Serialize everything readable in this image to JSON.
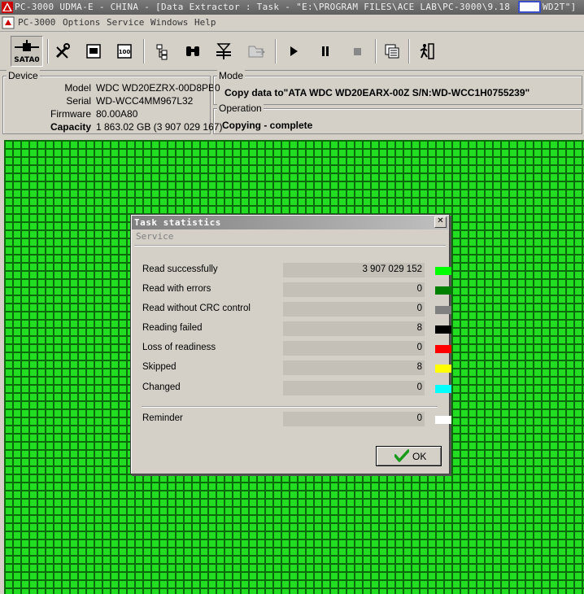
{
  "window": {
    "title": "PC-3000 UDMA-E - CHINA - [Data Extractor : Task - \"E:\\PROGRAM FILES\\ACE LAB\\PC-3000\\9.18",
    "title_tail": "WD2T\"]"
  },
  "menu": {
    "items": [
      "PC-3000",
      "Options",
      "Service",
      "Windows",
      "Help"
    ]
  },
  "toolbar": {
    "port_label": "SATA0",
    "icons": [
      "connector-icon",
      "tools-icon",
      "firmware-icon",
      "percent-icon",
      "tree-icon",
      "binoculars-icon",
      "sort-icon",
      "export-icon",
      "play-icon",
      "pause-icon",
      "stop-icon",
      "copy-icon",
      "exit-icon"
    ]
  },
  "device": {
    "group_label": "Device",
    "rows": [
      {
        "key": "Model",
        "value": "WDC WD20EZRX-00D8PB0"
      },
      {
        "key": "Serial",
        "value": "WD-WCC4MM967L32"
      },
      {
        "key": "Firmware",
        "value": "80.00A80"
      },
      {
        "key": "Capacity",
        "value": "1 863.02 GB (3 907 029 167)"
      }
    ]
  },
  "mode": {
    "group_label": "Mode",
    "text": "Copy data to\"ATA WDC WD20EARX-00Z S/N:WD-WCC1H0755239\""
  },
  "operation": {
    "group_label": "Operation",
    "text": "Copying - complete"
  },
  "dialog": {
    "title": "Task statistics",
    "menu": "Service",
    "rows": [
      {
        "label": "Read successfully",
        "value": "3 907 029 152",
        "color": "#00ff00"
      },
      {
        "label": "Read with errors",
        "value": "0",
        "color": "#008000"
      },
      {
        "label": "Read without CRC control",
        "value": "0",
        "color": "#808080"
      },
      {
        "label": "Reading failed",
        "value": "8",
        "color": "#000000"
      },
      {
        "label": "Loss of readiness",
        "value": "0",
        "color": "#ff0000"
      },
      {
        "label": "Skipped",
        "value": "8",
        "color": "#ffff00"
      },
      {
        "label": "Changed",
        "value": "0",
        "color": "#00ffff"
      }
    ],
    "reminder": {
      "label": "Reminder",
      "value": "0",
      "color": "#ffffff"
    },
    "ok_label": "OK"
  },
  "colors": {
    "block_ok": "#22dd22",
    "grid_line": "#0b6b0b",
    "title_bar": "#6e6e6e"
  }
}
